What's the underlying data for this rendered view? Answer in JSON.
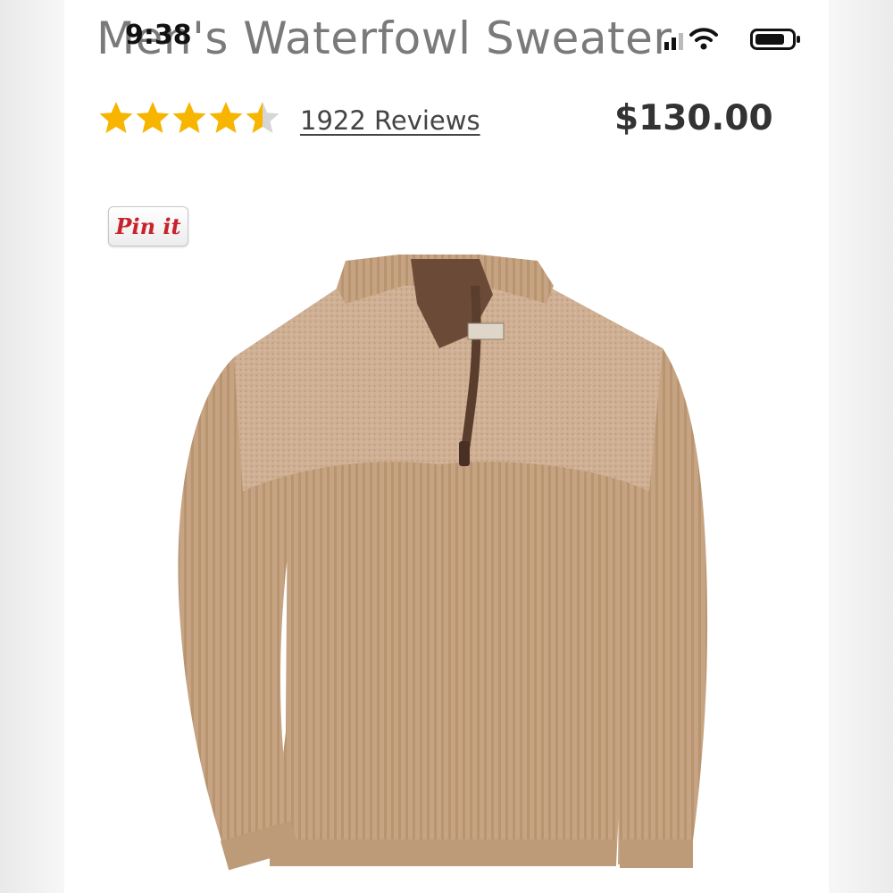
{
  "status_bar": {
    "time": "9:38"
  },
  "product": {
    "title": "Men's Waterfowl Sweater",
    "rating": 4.5,
    "rating_max": 5,
    "reviews_label": "1922 Reviews",
    "price": "$130.00",
    "image_alt": "Men's Waterfowl Sweater"
  },
  "share": {
    "pin_label": "Pin it"
  },
  "colors": {
    "star": "#f7b500",
    "star_empty": "#d6d6d6",
    "sweater": "#c8a584",
    "collar": "#6b4a37",
    "pin_red": "#c8232c"
  },
  "icons": [
    "signal-icon",
    "wifi-icon",
    "battery-icon",
    "star-icon"
  ]
}
